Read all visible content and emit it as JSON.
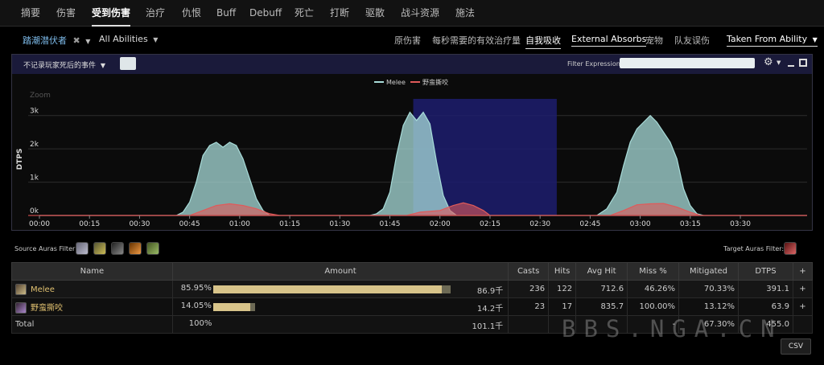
{
  "tabs": [
    {
      "label": "摘要"
    },
    {
      "label": "伤害"
    },
    {
      "label": "受到伤害"
    },
    {
      "label": "治疗"
    },
    {
      "label": "仇恨"
    },
    {
      "label": "Buff"
    },
    {
      "label": "Debuff"
    },
    {
      "label": "死亡"
    },
    {
      "label": "打断"
    },
    {
      "label": "驱散"
    },
    {
      "label": "战斗资源"
    },
    {
      "label": "施法"
    }
  ],
  "filters": {
    "target": "踏潮潜伏者",
    "abilities": "All Abilities",
    "options": [
      "原伤害",
      "每秒需要的有效治疗量",
      "自我吸收",
      "External Absorbs",
      "宠物",
      "队友误伤"
    ],
    "taken_from": "Taken From Ability"
  },
  "panel": {
    "events_dropdown": "不记录玩家死后的事件",
    "filter_label": "Filter Expression:",
    "filter_value": ""
  },
  "chart_data": {
    "type": "area",
    "title": "",
    "ylabel": "DTPS",
    "zoom_label": "Zoom",
    "ylim": [
      0,
      3500
    ],
    "y_ticks": [
      "0k",
      "1k",
      "2k",
      "3k"
    ],
    "x_ticks": [
      "00:00",
      "00:15",
      "00:30",
      "00:45",
      "01:00",
      "01:15",
      "01:30",
      "01:45",
      "02:00",
      "02:15",
      "02:30",
      "02:45",
      "03:00",
      "03:15",
      "03:30"
    ],
    "xlim": [
      0,
      230
    ],
    "highlight_range": [
      112,
      155
    ],
    "colors": {
      "Melee": "#a8dcd9",
      "野蛮撕咬": "#e05a5a"
    },
    "legend": [
      "Melee",
      "野蛮撕咬"
    ],
    "series": [
      {
        "name": "Melee",
        "points": [
          [
            0,
            0
          ],
          [
            41,
            0
          ],
          [
            43,
            100
          ],
          [
            45,
            400
          ],
          [
            47,
            1000
          ],
          [
            49,
            1800
          ],
          [
            51,
            2100
          ],
          [
            53,
            2200
          ],
          [
            55,
            2050
          ],
          [
            57,
            2200
          ],
          [
            59,
            2100
          ],
          [
            61,
            1700
          ],
          [
            63,
            1100
          ],
          [
            65,
            500
          ],
          [
            67,
            150
          ],
          [
            69,
            0
          ],
          [
            99,
            0
          ],
          [
            101,
            50
          ],
          [
            103,
            200
          ],
          [
            105,
            700
          ],
          [
            107,
            1800
          ],
          [
            109,
            2700
          ],
          [
            111,
            3100
          ],
          [
            113,
            2850
          ],
          [
            115,
            3100
          ],
          [
            117,
            2750
          ],
          [
            119,
            1600
          ],
          [
            121,
            600
          ],
          [
            123,
            150
          ],
          [
            125,
            0
          ],
          [
            167,
            0
          ],
          [
            170,
            200
          ],
          [
            173,
            700
          ],
          [
            175,
            1500
          ],
          [
            177,
            2200
          ],
          [
            179,
            2600
          ],
          [
            181,
            2800
          ],
          [
            183,
            3000
          ],
          [
            185,
            2800
          ],
          [
            187,
            2500
          ],
          [
            189,
            2200
          ],
          [
            191,
            1700
          ],
          [
            193,
            800
          ],
          [
            195,
            300
          ],
          [
            197,
            50
          ],
          [
            199,
            0
          ],
          [
            230,
            0
          ]
        ]
      },
      {
        "name": "野蛮撕咬",
        "points": [
          [
            0,
            0
          ],
          [
            45,
            0
          ],
          [
            49,
            150
          ],
          [
            53,
            300
          ],
          [
            57,
            350
          ],
          [
            61,
            300
          ],
          [
            65,
            200
          ],
          [
            69,
            50
          ],
          [
            72,
            0
          ],
          [
            110,
            0
          ],
          [
            114,
            100
          ],
          [
            120,
            150
          ],
          [
            124,
            300
          ],
          [
            127,
            380
          ],
          [
            130,
            300
          ],
          [
            133,
            150
          ],
          [
            135,
            0
          ],
          [
            171,
            0
          ],
          [
            175,
            150
          ],
          [
            179,
            320
          ],
          [
            183,
            350
          ],
          [
            187,
            360
          ],
          [
            191,
            250
          ],
          [
            195,
            100
          ],
          [
            198,
            0
          ],
          [
            230,
            0
          ]
        ]
      }
    ]
  },
  "auras": {
    "source_label": "Source Auras Filter:",
    "target_label": "Target Auras Filter:",
    "source_icons": [
      "aura-icon-1",
      "aura-icon-2",
      "aura-icon-3",
      "aura-icon-4",
      "aura-icon-5"
    ],
    "target_icons": [
      "target-aura-icon"
    ]
  },
  "table": {
    "headers": [
      "Name",
      "Amount",
      "Casts",
      "Hits",
      "Avg Hit",
      "Miss %",
      "Mitigated",
      "DTPS",
      "+"
    ],
    "rows": [
      {
        "name": "Melee",
        "pct": "85.95%",
        "amount": "86.9千",
        "casts": "236",
        "hits": "122",
        "avg_hit": "712.6",
        "miss": "46.26%",
        "mitigated": "70.33%",
        "dtps": "391.1",
        "bar": 0.9,
        "bar_dark": 0.035
      },
      {
        "name": "野蛮撕咬",
        "pct": "14.05%",
        "amount": "14.2千",
        "casts": "23",
        "hits": "17",
        "avg_hit": "835.7",
        "miss": "100.00%",
        "mitigated": "13.12%",
        "dtps": "63.9",
        "bar": 0.147,
        "bar_dark": 0.018
      }
    ],
    "total": {
      "name": "Total",
      "pct": "100%",
      "amount": "101.1千",
      "casts": "",
      "hits": "",
      "avg_hit": "",
      "miss": "-",
      "mitigated": "67.30%",
      "dtps": "455.0"
    }
  },
  "buttons": {
    "csv": "CSV"
  },
  "watermark": "BBS.NGA.CN"
}
